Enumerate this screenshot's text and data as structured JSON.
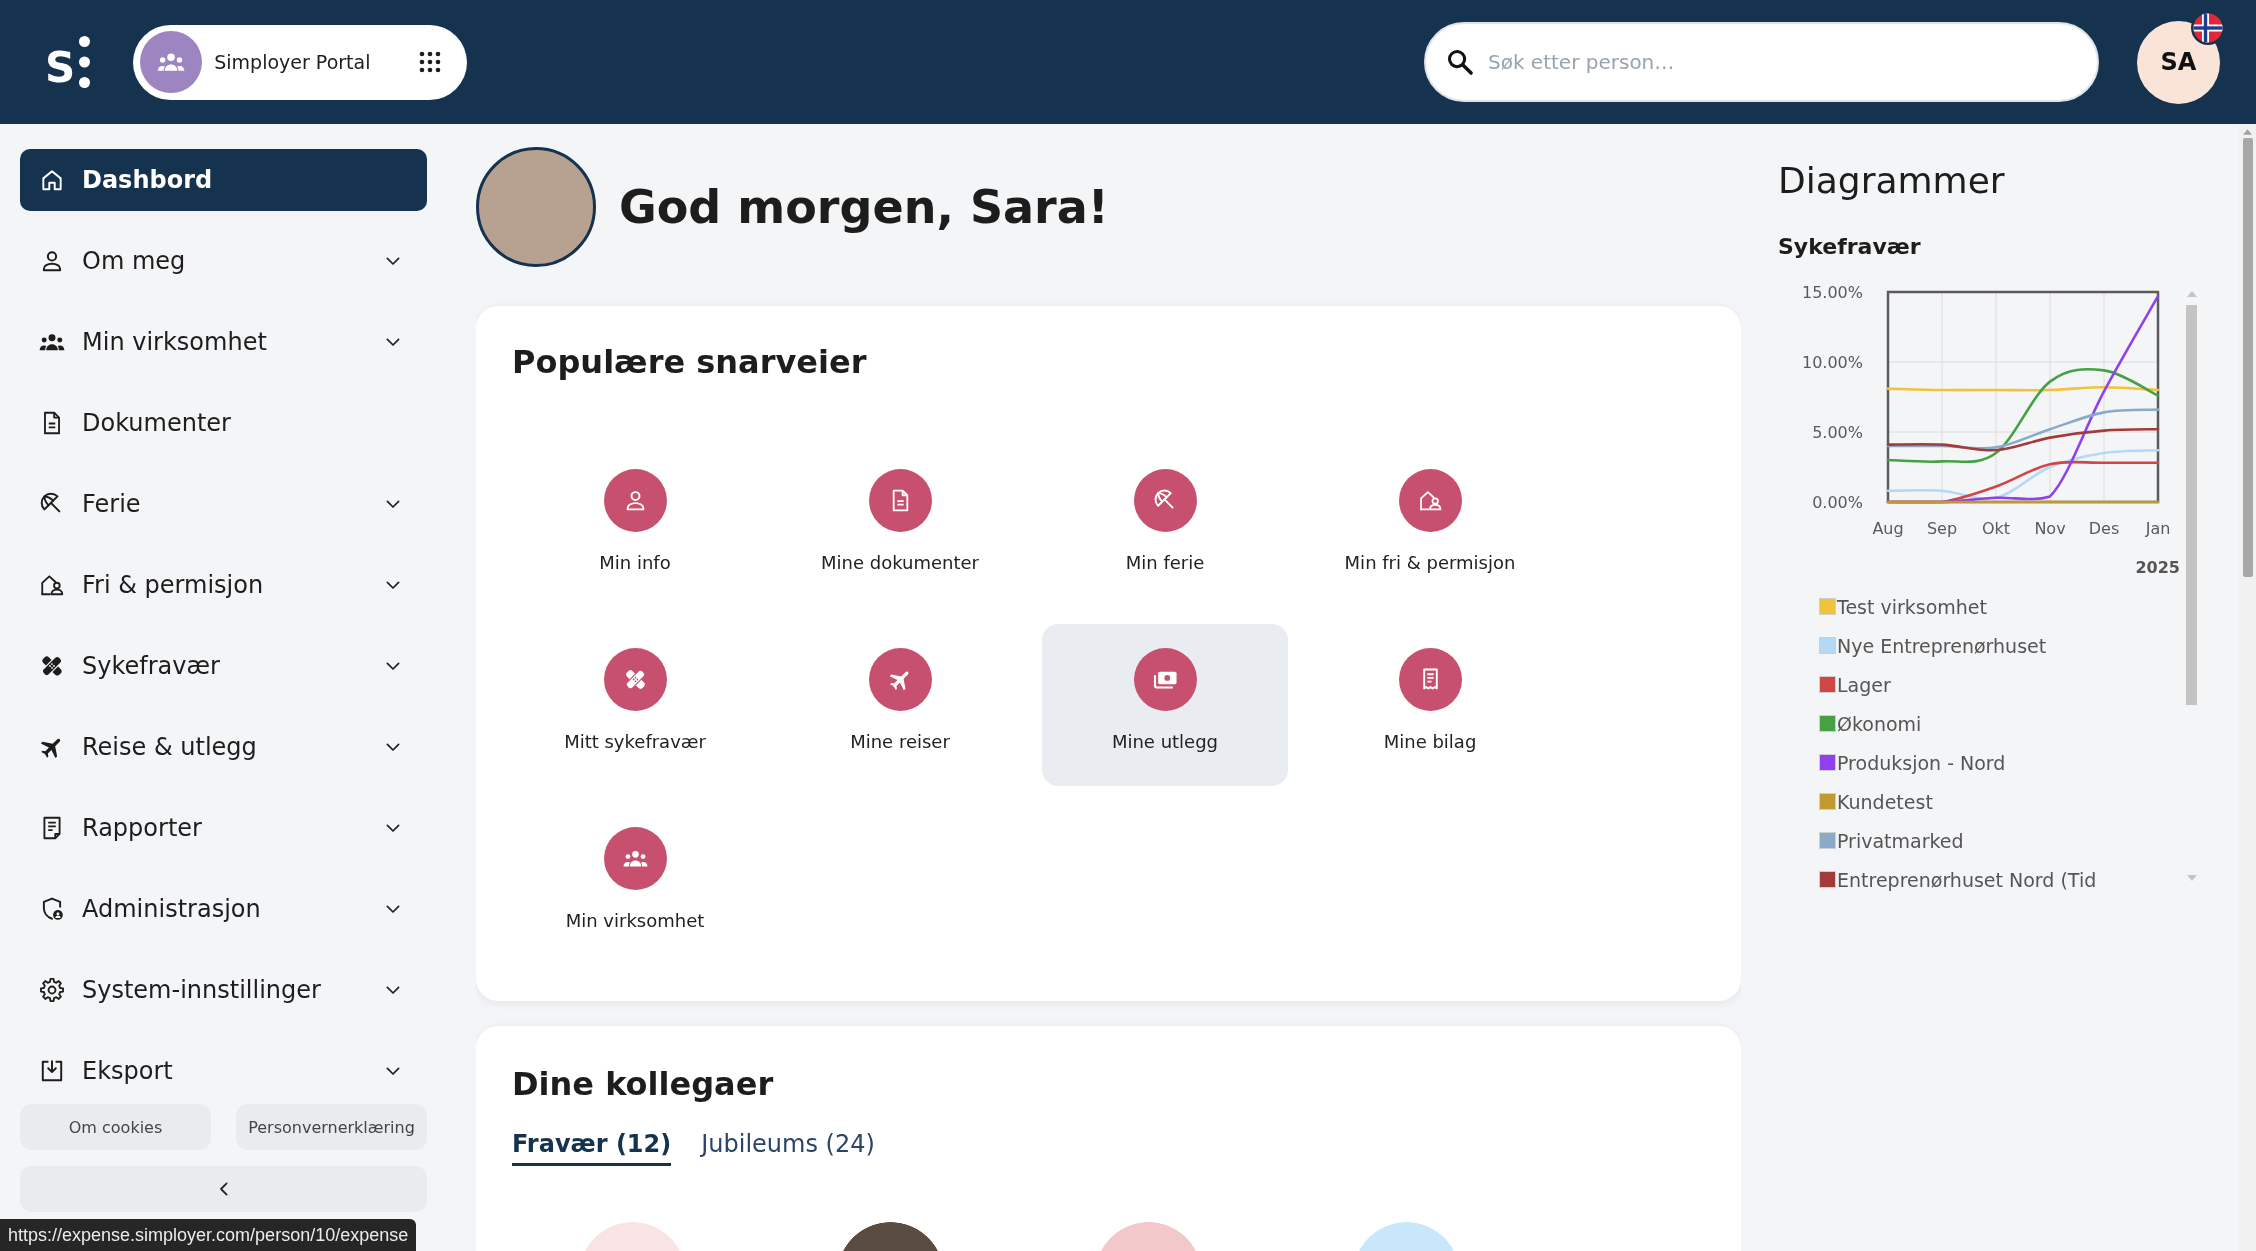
{
  "header": {
    "logo": "S",
    "portal": {
      "label": "Simployer Portal"
    },
    "search": {
      "placeholder": "Søk etter person…"
    },
    "user": {
      "initials": "SA"
    }
  },
  "sidebar": {
    "items": [
      {
        "label": "Dashbord",
        "kind": "link",
        "selected": true
      },
      {
        "label": "Om meg",
        "kind": "group",
        "selected": false
      },
      {
        "label": "Min virksomhet",
        "kind": "group",
        "selected": false
      },
      {
        "label": "Dokumenter",
        "kind": "link",
        "selected": false
      },
      {
        "label": "Ferie",
        "kind": "group",
        "selected": false
      },
      {
        "label": "Fri & permisjon",
        "kind": "group",
        "selected": false
      },
      {
        "label": "Sykefravær",
        "kind": "group",
        "selected": false
      },
      {
        "label": "Reise & utlegg",
        "kind": "group",
        "selected": false
      },
      {
        "label": "Rapporter",
        "kind": "group",
        "selected": false
      },
      {
        "label": "Administrasjon",
        "kind": "group",
        "selected": false
      },
      {
        "label": "System-innstillinger",
        "kind": "group",
        "selected": false
      },
      {
        "label": "Eksport",
        "kind": "group",
        "selected": false
      }
    ],
    "footer_links": [
      "Om cookies",
      "Personvernerklæring"
    ]
  },
  "greeting": {
    "text": "God morgen, Sara!"
  },
  "shortcuts": {
    "title": "Populære snarveier",
    "items": [
      {
        "label": "Min info",
        "hovered": false
      },
      {
        "label": "Mine dokumenter",
        "hovered": false
      },
      {
        "label": "Min ferie",
        "hovered": false
      },
      {
        "label": "Min fri & permisjon",
        "hovered": false
      },
      {
        "label": "Mitt sykefravær",
        "hovered": false
      },
      {
        "label": "Mine reiser",
        "hovered": false
      },
      {
        "label": "Mine utlegg",
        "hovered": true
      },
      {
        "label": "Mine bilag",
        "hovered": false
      },
      {
        "label": "Min virksomhet",
        "hovered": false
      }
    ]
  },
  "colleagues": {
    "title": "Dine kollegaer",
    "tabs": [
      {
        "label": "Fravær (12)",
        "selected": true
      },
      {
        "label": "Jubileums (24)",
        "selected": false
      }
    ],
    "avatars": [
      {
        "kind": "tinted",
        "color": "#f9e3e5"
      },
      {
        "kind": "photo"
      },
      {
        "kind": "tinted",
        "color": "#f2c8ca"
      },
      {
        "kind": "tinted",
        "color": "#c8e7fb"
      }
    ]
  },
  "charts_panel": {
    "title": "Diagrammer",
    "chart_data": {
      "type": "line",
      "title": "Sykefravær",
      "categories": [
        "Aug",
        "Sep",
        "Okt",
        "Nov",
        "Des",
        "Jan"
      ],
      "xlabel": "2025",
      "ylim": [
        0,
        15
      ],
      "yticks": [
        {
          "value": 0,
          "label": "0.00%"
        },
        {
          "value": 5,
          "label": "5.00%"
        },
        {
          "value": 10,
          "label": "10.00%"
        },
        {
          "value": 15,
          "label": "15.00%"
        }
      ],
      "grid": true,
      "legend": true,
      "series": [
        {
          "name": "Test virksomhet",
          "color": "#f0c33c",
          "values": [
            8.1,
            8.0,
            8.0,
            8.0,
            8.2,
            8.0
          ]
        },
        {
          "name": "Nye Entreprenørhuset",
          "color": "#b3d9f7",
          "values": [
            0.8,
            0.8,
            0.3,
            2.5,
            3.5,
            3.7
          ]
        },
        {
          "name": "Lager",
          "color": "#d04646",
          "values": [
            0,
            0,
            1.1,
            2.7,
            2.8,
            2.8
          ]
        },
        {
          "name": "Økonomi",
          "color": "#46a046",
          "values": [
            3.0,
            2.9,
            3.5,
            8.6,
            9.4,
            7.6
          ]
        },
        {
          "name": "Produksjon - Nord",
          "color": "#9140ee",
          "values": [
            0,
            0,
            0.3,
            0.4,
            7.9,
            14.7
          ]
        },
        {
          "name": "Kundetest",
          "color": "#c09a2e",
          "values": [
            0,
            0,
            0,
            0,
            0,
            0
          ]
        },
        {
          "name": "Privatmarked",
          "color": "#8aaac8",
          "values": [
            4.0,
            4.0,
            3.9,
            5.2,
            6.4,
            6.6
          ]
        },
        {
          "name": "Entreprenørhuset Nord (Tid",
          "color": "#a33b3b",
          "values": [
            4.1,
            4.1,
            3.7,
            4.6,
            5.1,
            5.2
          ]
        }
      ]
    }
  },
  "status_bar": {
    "url": "https://expense.simployer.com/person/10/expense"
  }
}
